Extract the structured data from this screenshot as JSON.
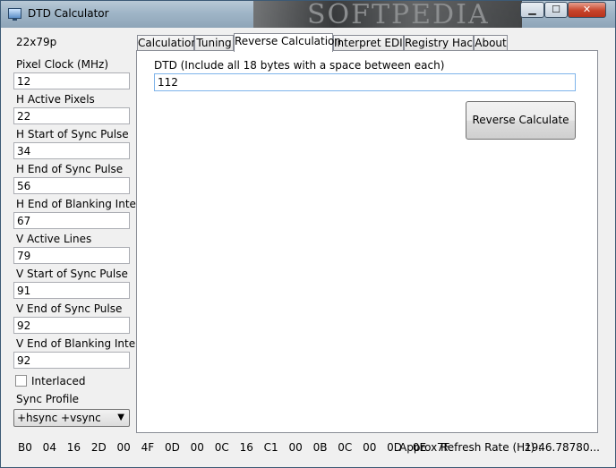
{
  "window": {
    "title": "DTD Calculator",
    "watermark": "SOFTPEDIA"
  },
  "title_buttons": {
    "minimize": "▁",
    "maximize": "☐",
    "close": "✕"
  },
  "resolution": "22x79p",
  "fields": [
    {
      "label": "Pixel Clock (MHz)",
      "value": "12"
    },
    {
      "label": "H Active Pixels",
      "value": "22"
    },
    {
      "label": "H Start of Sync Pulse",
      "value": "34"
    },
    {
      "label": "H End of Sync Pulse",
      "value": "56"
    },
    {
      "label": "H End of Blanking Interval",
      "value": "67"
    },
    {
      "label": "V Active Lines",
      "value": "79"
    },
    {
      "label": "V Start of Sync Pulse",
      "value": "91"
    },
    {
      "label": "V End of Sync Pulse",
      "value": "92"
    },
    {
      "label": "V End of Blanking Interval",
      "value": "92"
    }
  ],
  "interlaced": {
    "label": "Interlaced",
    "checked": false
  },
  "sync_profile": {
    "label": "Sync Profile",
    "selected": "+hsync +vsync"
  },
  "tabs": [
    {
      "label": "Calculation"
    },
    {
      "label": "Tuning"
    },
    {
      "label": "Reverse Calculation"
    },
    {
      "label": "Interpret EDID"
    },
    {
      "label": "Registry Hack"
    },
    {
      "label": "About"
    }
  ],
  "reverse": {
    "dtd_label": "DTD (Include all 18 bytes with a space between each)",
    "dtd_value": "112",
    "button_label": "Reverse Calculate"
  },
  "status": {
    "bytes": "B0 04 16 2D 00 4F 0D 00 0C 16 C1 00 0B 0C 00 0D 0E 7F",
    "refresh_label": "Approx Refresh Rate (Hz) :",
    "refresh_value": "1946.78780..."
  },
  "colors": {
    "active_input_border": "#7eb4ea",
    "close_button": "#c7442a"
  }
}
